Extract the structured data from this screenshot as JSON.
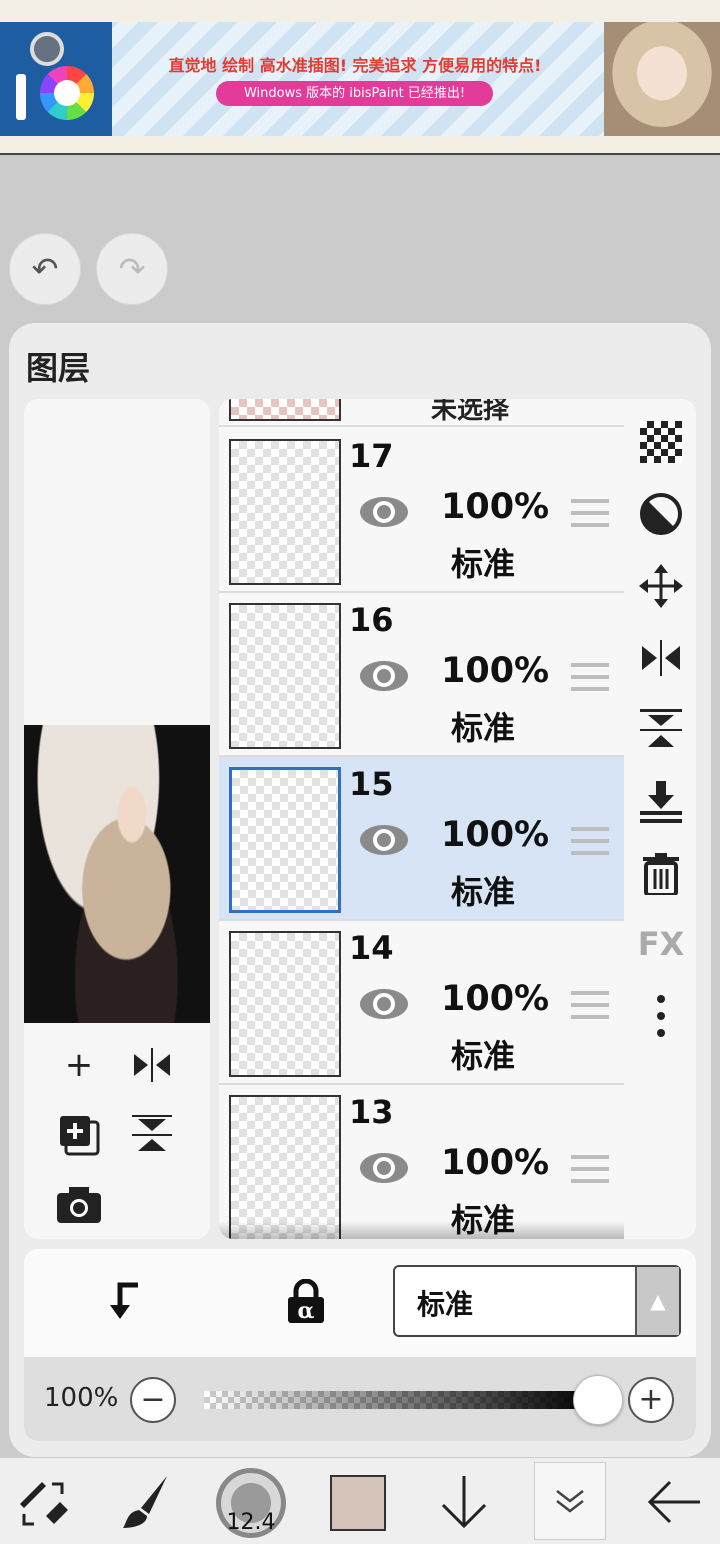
{
  "ad": {
    "headline": "直觉地 绘制 高水准插图! 完美追求 方便易用的特点!",
    "subline": "Windows 版本的 ibisPaint 已经推出!"
  },
  "history": {
    "undo_icon": "undo-icon",
    "redo_icon": "redo-icon"
  },
  "panel": {
    "title": "图层",
    "partial_layer_text": "未选择",
    "layers": [
      {
        "number": "17",
        "opacity": "100%",
        "mode": "标准",
        "selected": false
      },
      {
        "number": "16",
        "opacity": "100%",
        "mode": "标准",
        "selected": false
      },
      {
        "number": "15",
        "opacity": "100%",
        "mode": "标准",
        "selected": true
      },
      {
        "number": "14",
        "opacity": "100%",
        "mode": "标准",
        "selected": false
      },
      {
        "number": "13",
        "opacity": "100%",
        "mode": "标准",
        "selected": false
      }
    ],
    "side_tools": [
      "transparency-icon",
      "invert-icon",
      "move-icon",
      "flip-horizontal-icon",
      "flip-vertical-icon",
      "merge-down-icon",
      "trash-icon",
      "fx-icon",
      "more-icon"
    ],
    "fx_label": "FX"
  },
  "settings": {
    "blend_mode": "标准",
    "opacity_label": "100%",
    "opacity_value": 1.0
  },
  "toolbar": {
    "brush_size": "12.4",
    "color": "#d3c3b8"
  }
}
